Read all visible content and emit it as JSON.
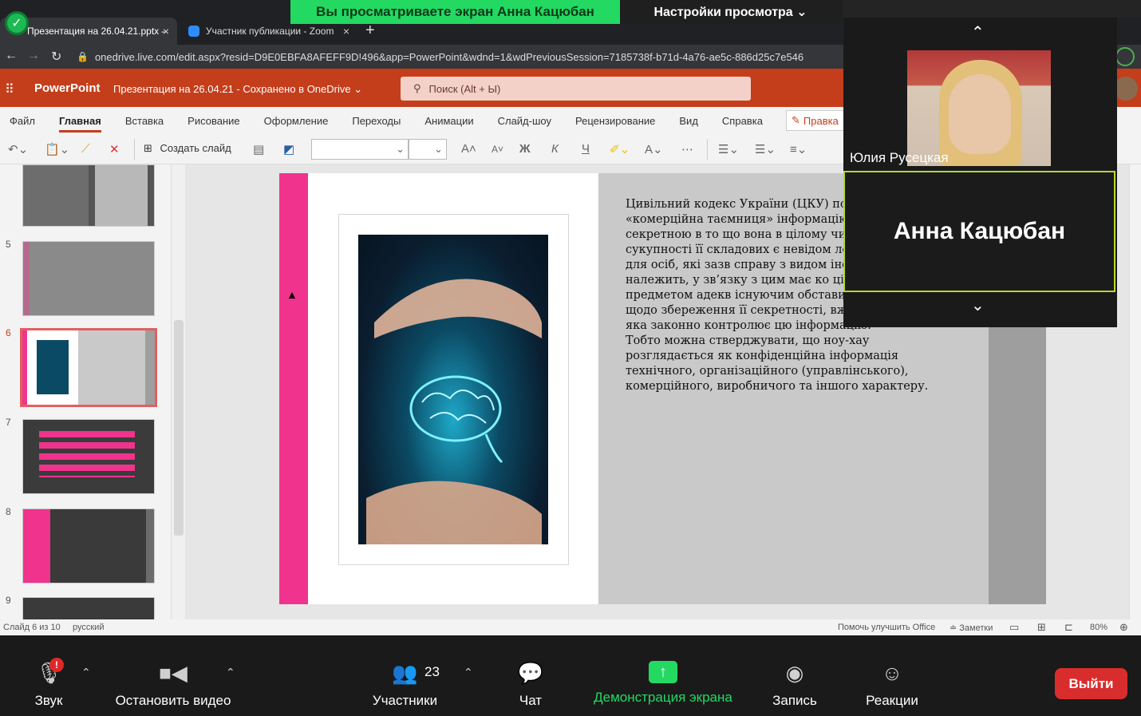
{
  "browser": {
    "tabs": [
      {
        "label": "Презентация на 26.04.21.pptx –",
        "close": "×"
      },
      {
        "label": "Участник публикации - Zoom",
        "close": "×"
      }
    ],
    "new_tab": "+",
    "url": "onedrive.live.com/edit.aspx?resid=D9E0EBFA8AFEFF9D!496&app=PowerPoint&wdnd=1&wdPreviousSession=7185738f-b71d-4a76-ae5c-886d25c7e546"
  },
  "share_banner": {
    "text": "Вы просматриваете экран Анна Кацюбан",
    "view_options": "Настройки просмотра ⌄"
  },
  "ppt": {
    "app": "PowerPoint",
    "doc": "Презентация на 26.04.21  -  Сохранено в OneDrive ⌄",
    "search": "Поиск (Alt + Ы)",
    "ribbon_tabs": [
      "Файл",
      "Главная",
      "Вставка",
      "Рисование",
      "Оформление",
      "Переходы",
      "Анимации",
      "Слайд-шоу",
      "Рецензирование",
      "Вид",
      "Справка"
    ],
    "edit_button": "Правка",
    "new_slide": "Создать слайд",
    "font_buttons": [
      "A˄",
      "A˅",
      "Ж",
      "К",
      "Ч"
    ],
    "thumb_numbers": [
      "5",
      "6",
      "7",
      "8",
      "9"
    ],
    "slide_text": "Цивільний кодекс України (ЦКУ) поняття «комерційна таємниця» інформацію, яка є секретною в то що вона в цілому чи в певній фор сукупності її складових є невідом легкодоступною для осіб, які зазв справу з видом інформації, до як належить, у зв’язку з цим має ко цінність та була предметом адекв існуючим обставинам заходів щодо збереження її секретності, вжитих особою, яка законно контролює цю інформацію.\nТобто можна стверджувати, що ноу-хау розглядається як конфіденційна інформація технічного, організаційного (управлінського), комерційного, виробничого та іншого характеру.",
    "status": {
      "slide": "Слайд 6 из 10",
      "language": "русский",
      "help": "Помочь улучшить Office",
      "notes": "Заметки",
      "zoom": "80%"
    }
  },
  "zoom": {
    "participant1": "Юлия Русецкая",
    "participant2": "Анна Кацюбан",
    "toolbar": {
      "audio": "Звук",
      "video": "Остановить видео",
      "participants": "Участники",
      "participants_count": "23",
      "chat": "Чат",
      "share": "Демонстрация экрана",
      "record": "Запись",
      "reactions": "Реакции",
      "leave": "Выйти"
    },
    "colors": {
      "share_green": "#23d962",
      "leave_red": "#d92d2d",
      "ppt_orange": "#c43e1c",
      "slide_pink": "#f0338d"
    }
  }
}
